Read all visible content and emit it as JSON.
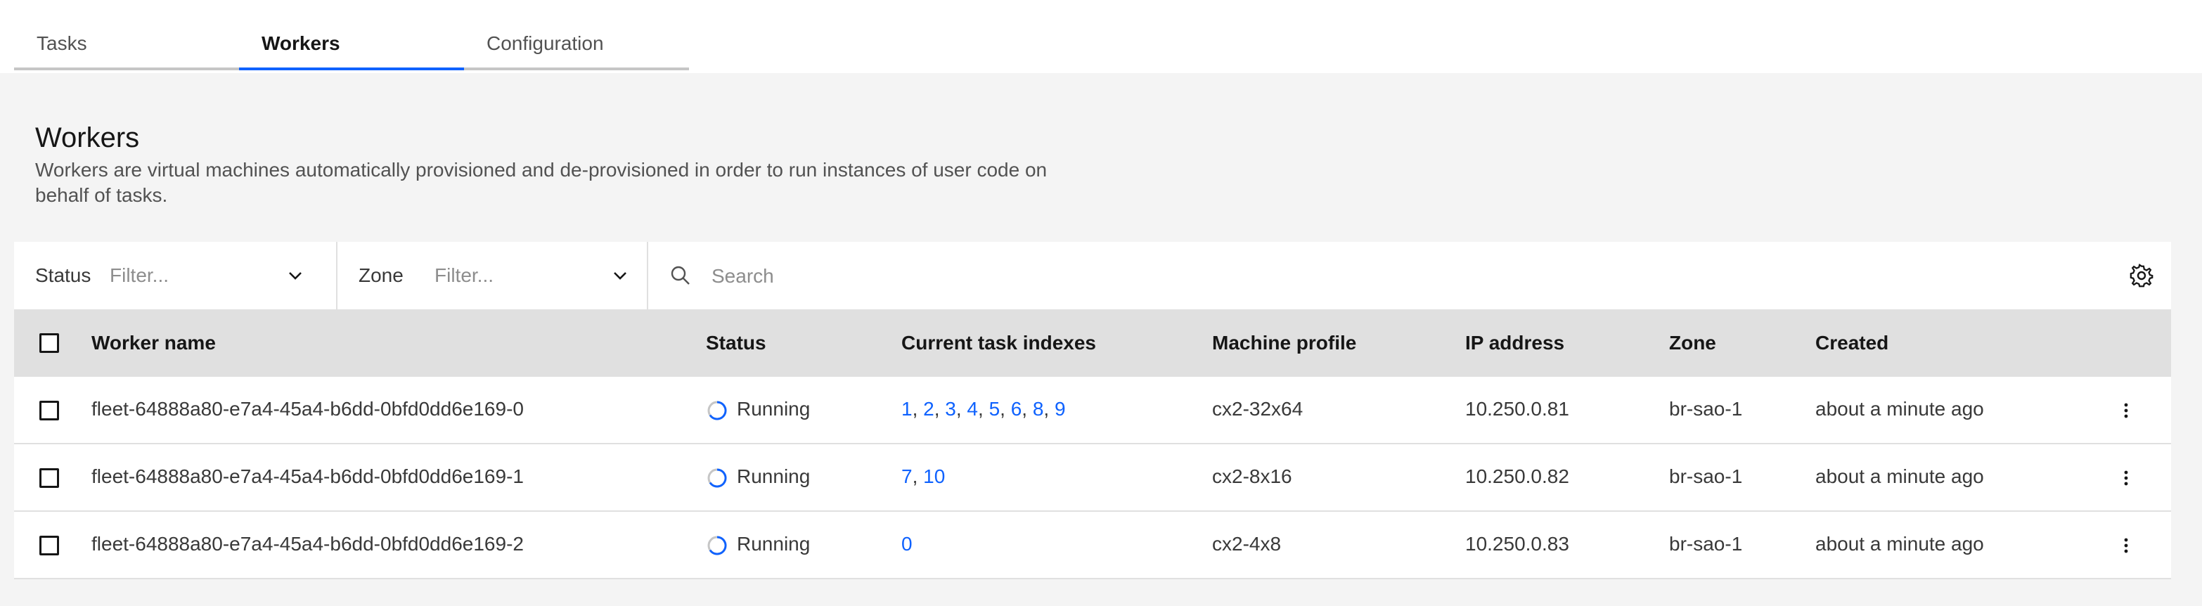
{
  "tabs": [
    {
      "label": "Tasks",
      "active": false
    },
    {
      "label": "Workers",
      "active": true
    },
    {
      "label": "Configuration",
      "active": false
    }
  ],
  "section": {
    "title": "Workers",
    "description": "Workers are virtual machines automatically provisioned and de-provisioned in order to run instances of user code on behalf of tasks."
  },
  "toolbar": {
    "status_filter": {
      "label": "Status",
      "placeholder": "Filter..."
    },
    "zone_filter": {
      "label": "Zone",
      "placeholder": "Filter..."
    },
    "search": {
      "placeholder": "Search"
    },
    "icons": {
      "search": "search-icon",
      "settings": "gear-icon",
      "chevron": "chevron-down-icon"
    }
  },
  "table": {
    "headers": {
      "name": "Worker name",
      "status": "Status",
      "tasks": "Current task indexes",
      "profile": "Machine profile",
      "ip": "IP address",
      "zone": "Zone",
      "created": "Created"
    },
    "rows": [
      {
        "name": "fleet-64888a80-e7a4-45a4-b6dd-0bfd0dd6e169-0",
        "status": "Running",
        "tasks": [
          "1",
          "2",
          "3",
          "4",
          "5",
          "6",
          "8",
          "9"
        ],
        "profile": "cx2-32x64",
        "ip": "10.250.0.81",
        "zone": "br-sao-1",
        "created": "about a minute ago"
      },
      {
        "name": "fleet-64888a80-e7a4-45a4-b6dd-0bfd0dd6e169-1",
        "status": "Running",
        "tasks": [
          "7",
          "10"
        ],
        "profile": "cx2-8x16",
        "ip": "10.250.0.82",
        "zone": "br-sao-1",
        "created": "about a minute ago"
      },
      {
        "name": "fleet-64888a80-e7a4-45a4-b6dd-0bfd0dd6e169-2",
        "status": "Running",
        "tasks": [
          "0"
        ],
        "profile": "cx2-4x8",
        "ip": "10.250.0.83",
        "zone": "br-sao-1",
        "created": "about a minute ago"
      }
    ]
  },
  "colors": {
    "accent": "#0f62fe",
    "link": "#0f62fe",
    "header_bg": "#e0e0e0",
    "page_bg": "#f4f4f4"
  }
}
